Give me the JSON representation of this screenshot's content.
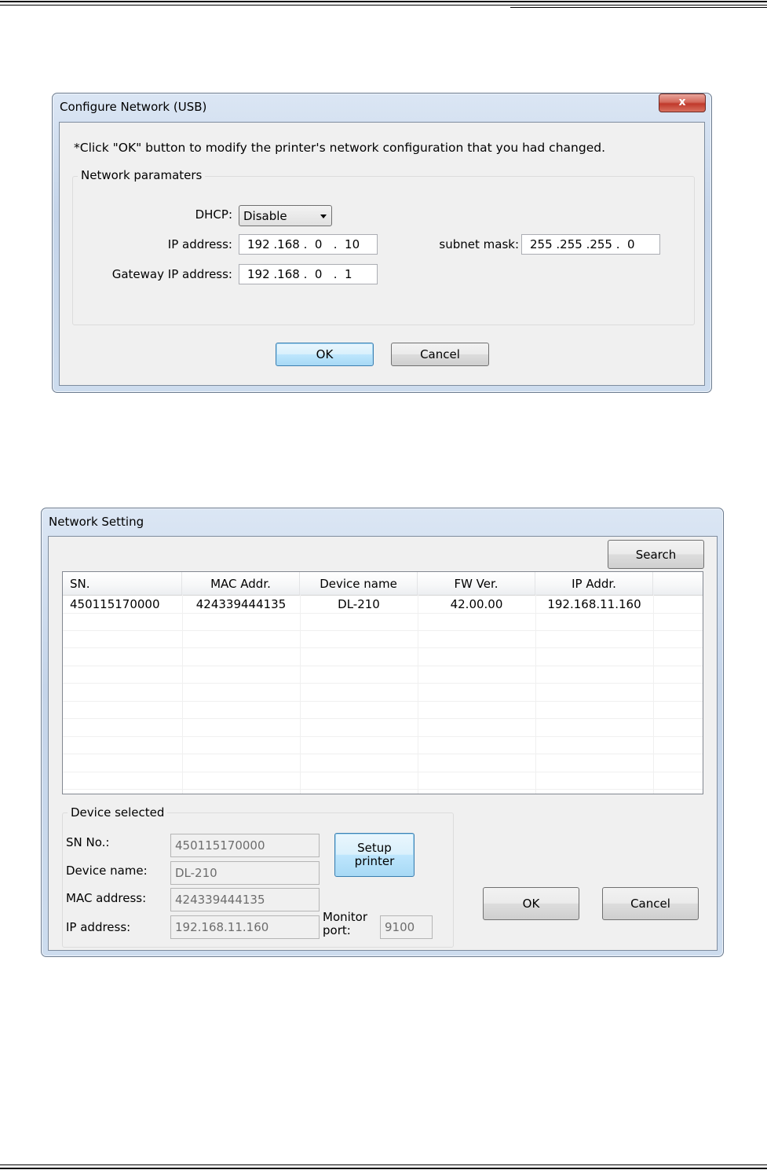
{
  "dialog1": {
    "title": "Configure Network (USB)",
    "close_glyph": "x",
    "instruction": "*Click \"OK\" button to modify the printer's network configuration that you had changed.",
    "group_label": "Network paramaters",
    "dhcp_label": "DHCP:",
    "dhcp_value": "Disable",
    "ip_label": "IP address:",
    "ip_value": "192 .168 .  0   .  10",
    "subnet_label": "subnet mask:",
    "subnet_value": "255 .255 .255 .  0",
    "gateway_label": "Gateway IP address:",
    "gateway_value": "192 .168 .  0   .  1",
    "ok_label": "OK",
    "cancel_label": "Cancel"
  },
  "dialog2": {
    "title": "Network Setting",
    "search_label": "Search",
    "columns": [
      "SN.",
      "MAC Addr.",
      "Device name",
      "FW Ver.",
      "IP Addr."
    ],
    "rows": [
      [
        "450115170000",
        "424339444135",
        "DL-210",
        "42.00.00",
        "192.168.11.160"
      ]
    ],
    "device_group_label": "Device selected",
    "sn_label": "SN No.:",
    "sn_value": "450115170000",
    "device_name_label": "Device name:",
    "device_name_value": "DL-210",
    "mac_label": "MAC address:",
    "mac_value": "424339444135",
    "ip_label": "IP address:",
    "ip_value": "192.168.11.160",
    "monitor_label_1": "Monitor",
    "monitor_label_2": "port:",
    "monitor_value": "9100",
    "setup_label_1": "Setup",
    "setup_label_2": "printer",
    "ok_label": "OK",
    "cancel_label": "Cancel"
  }
}
